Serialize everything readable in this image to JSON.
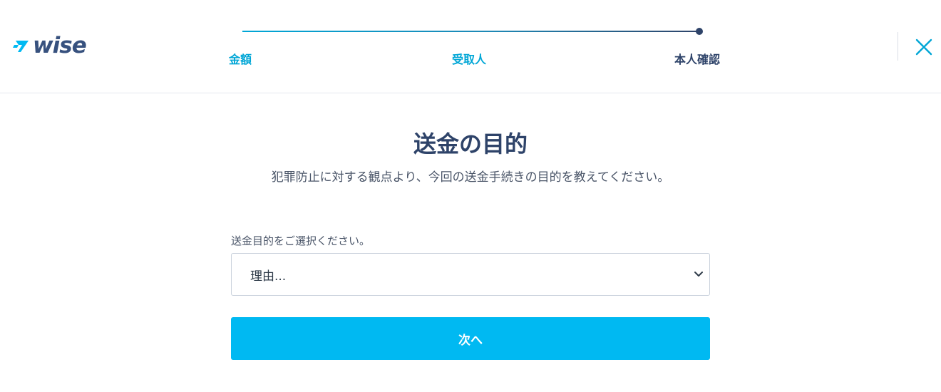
{
  "header": {
    "logo_text": "wise",
    "steps": [
      {
        "label": "金額",
        "state": "done"
      },
      {
        "label": "受取人",
        "state": "done"
      },
      {
        "label": "本人確認",
        "state": "current"
      }
    ],
    "close_icon": "close-icon"
  },
  "main": {
    "title": "送金の目的",
    "subtitle": "犯罪防止に対する観点より、今回の送金手続きの目的を教えてください。",
    "purpose_select": {
      "label": "送金目的をご選択ください。",
      "selected_value": "理由..."
    },
    "next_button_label": "次へ"
  },
  "colors": {
    "accent": "#00b9f2",
    "progress_done": "#00a6d6",
    "primary_text": "#2e4369"
  }
}
